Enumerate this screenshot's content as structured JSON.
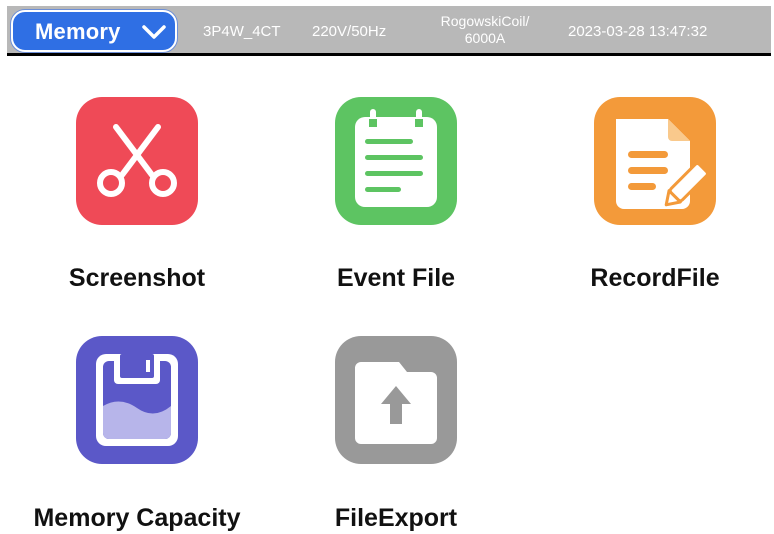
{
  "header": {
    "menu_label": "Memory",
    "wiring": "3P4W_4CT",
    "voltage": "220V/50Hz",
    "sensor_line1": "RogowskiCoil/",
    "sensor_line2": "6000A",
    "datetime": "2023-03-28 13:47:32"
  },
  "tiles": [
    {
      "label": "Screenshot",
      "icon": "scissors-icon",
      "color": "#ef4a57"
    },
    {
      "label": "Event File",
      "icon": "calendar-list-icon",
      "color": "#5dc462"
    },
    {
      "label": "RecordFile",
      "icon": "document-edit-icon",
      "color": "#f39a3a"
    },
    {
      "label": "Memory Capacity",
      "icon": "storage-capacity-icon",
      "color": "#5b58c8"
    },
    {
      "label": "FileExport",
      "icon": "folder-upload-icon",
      "color": "#999999"
    }
  ],
  "colors": {
    "topbar": "#b8b8b8",
    "menu_button": "#2f6fe4"
  }
}
